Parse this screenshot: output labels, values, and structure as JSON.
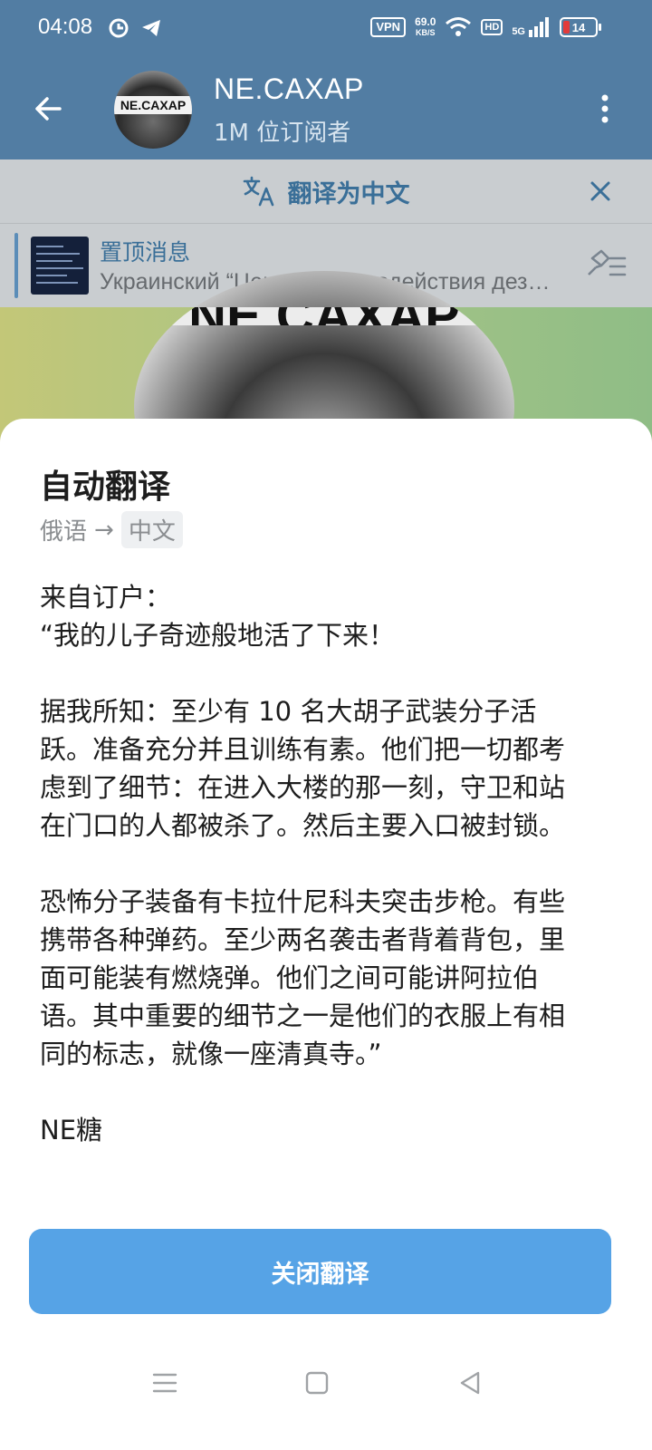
{
  "status_bar": {
    "time": "04:08",
    "vpn": "VPN",
    "net_speed": "69.0",
    "net_unit": "KB/S",
    "hd": "HD",
    "signal": "5G",
    "battery": "14"
  },
  "header": {
    "avatar_logo": "NE.CAXAP",
    "title": "NE.CAXAP",
    "subscribers": "1M 位订阅者"
  },
  "translate_bar": {
    "label": "翻译为中文"
  },
  "pinned": {
    "title": "置顶消息",
    "text": "Украинский “Центр противодействия дезинформации"
  },
  "background": {
    "logo": "NE.CAXAP"
  },
  "sheet": {
    "title": "自动翻译",
    "source_lang": "俄语",
    "arrow": "→",
    "target_lang": "中文",
    "text": "来自订户：\n“我的儿子奇迹般地活了下来！\n\n据我所知：至少有 10 名大胡子武装分子活跃。准备充分并且训练有素。他们把一切都考虑到了细节：在进入大楼的那一刻，守卫和站在门口的人都被杀了。然后主要入口被封锁。\n\n恐怖分子装备有卡拉什尼科夫突击步枪。有些携带各种弹药。至少两名袭击者背着背包，里面可能装有燃烧弹。他们之间可能讲阿拉伯语。其中重要的细节之一是他们的衣服上有相同的标志，就像一座清真寺。”\n\nNE糖",
    "close_button": "关闭翻译"
  },
  "colors": {
    "header_bg": "#527da3",
    "translate_bar_bg": "#c9cdd0",
    "accent_text": "#3a6f98",
    "button_bg": "#56a3e6"
  },
  "icons": {
    "back": "arrow-left-icon",
    "menu": "more-vertical-icon",
    "translate": "translate-icon",
    "close": "close-icon",
    "pin_list": "pin-list-icon",
    "nav_menu": "menu-lines-icon",
    "nav_home": "square-icon",
    "nav_back": "triangle-back-icon"
  }
}
